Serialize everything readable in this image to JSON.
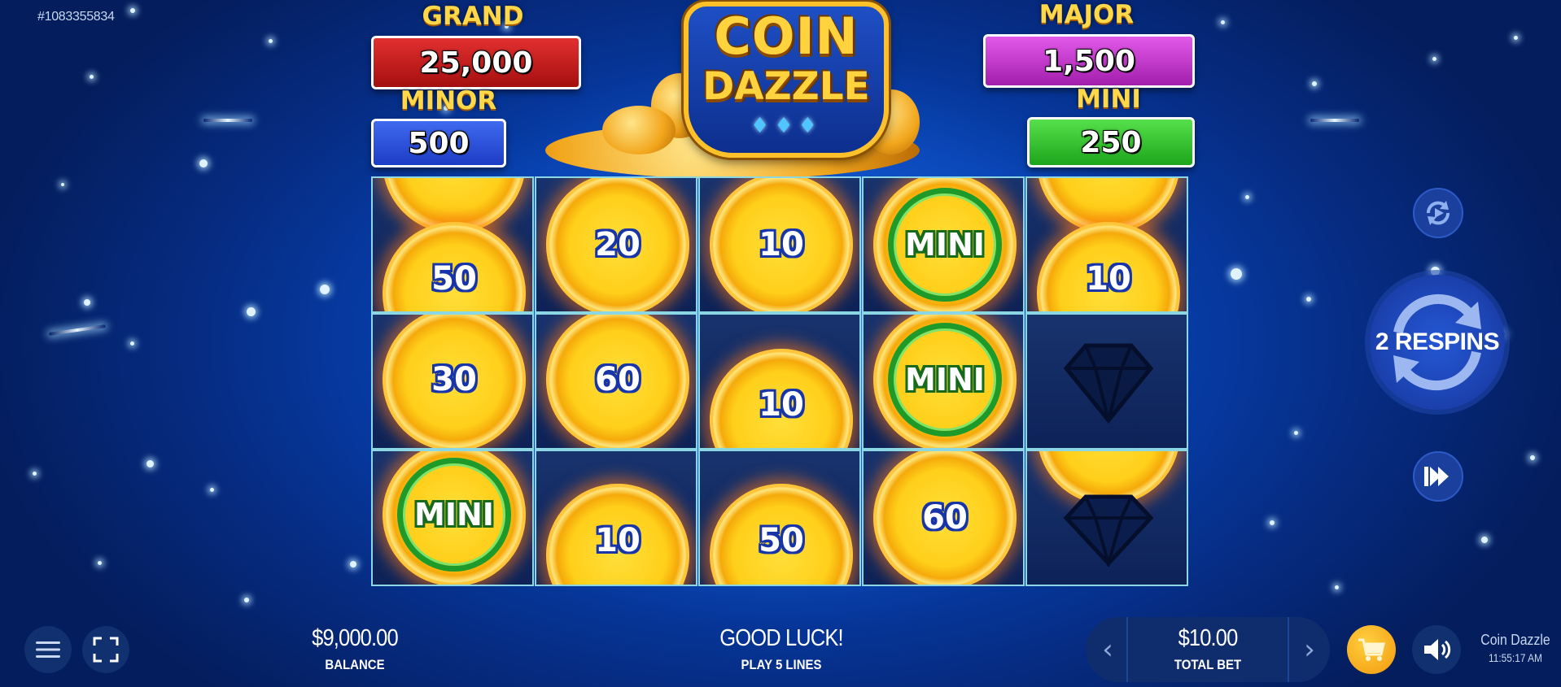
{
  "game_id": "#1083355834",
  "jackpots": {
    "grand": {
      "label": "GRAND",
      "value": "25,000"
    },
    "major": {
      "label": "MAJOR",
      "value": "1,500"
    },
    "minor": {
      "label": "MINOR",
      "value": "500"
    },
    "mini": {
      "label": "MINI",
      "value": "250"
    }
  },
  "logo": {
    "line1": "COIN",
    "line2": "DAZZLE",
    "gems": "♦♦♦"
  },
  "reels": {
    "columns": [
      [
        "",
        "50",
        "30",
        "MINI"
      ],
      [
        "20",
        "60",
        "",
        "10"
      ],
      [
        "10",
        "10",
        "50"
      ],
      [
        "MINI",
        "MINI",
        "60"
      ],
      [
        "",
        "10",
        "diamond",
        "",
        "diamond"
      ]
    ]
  },
  "respins": {
    "text": "2 RESPINS"
  },
  "bottom_bar": {
    "balance_value": "$9,000.00",
    "balance_label": "BALANCE",
    "message_primary": "GOOD LUCK!",
    "message_secondary": "PLAY 5 LINES",
    "bet_value": "$10.00",
    "bet_label": "TOTAL BET",
    "bet_decrease": "‹",
    "bet_increase": "›",
    "game_name": "Coin Dazzle",
    "clock": "11:55:17 AM"
  },
  "icons": {
    "menu": "hamburger-menu-icon",
    "fullscreen": "fullscreen-icon",
    "autoplay": "autoplay-icon",
    "turbo": "fast-forward-icon",
    "buy": "cart-icon",
    "sound": "speaker-icon"
  },
  "colors": {
    "grand": "#c31e1e",
    "major": "#c53ccd",
    "minor": "#2f54dd",
    "mini": "#37c232",
    "coin_gold": "#ffcf1a",
    "background": "#0642b4"
  }
}
